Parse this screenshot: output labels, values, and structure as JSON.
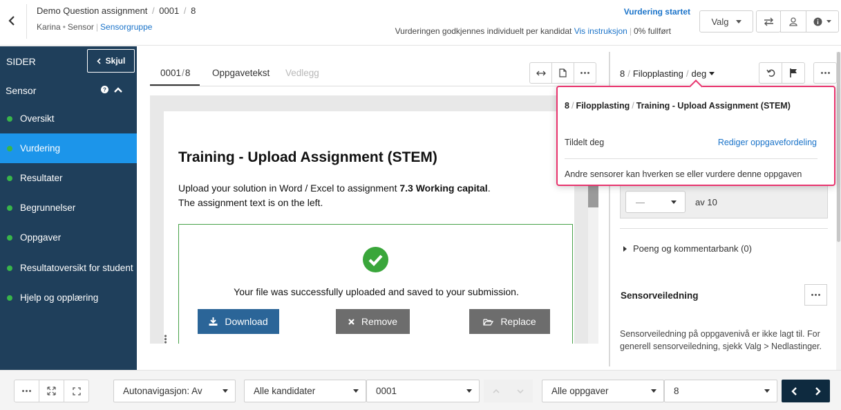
{
  "header": {
    "title": "Demo Question assignment",
    "candidate": "0001",
    "question_no": "8",
    "sensor_name": "Karina",
    "role": "Sensor",
    "group_link": "Sensorgruppe",
    "status_started": "Vurdering startet",
    "approval_text": "Vurderingen godkjennes individuelt per kandidat",
    "instructions_link": "Vis instruksjon",
    "progress_text": "0% fullført",
    "valg_label": "Valg"
  },
  "sidebar": {
    "title": "SIDER",
    "hide_label": "Skjul",
    "section": "Sensor",
    "items": [
      {
        "label": "Oversikt"
      },
      {
        "label": "Vurdering"
      },
      {
        "label": "Resultater"
      },
      {
        "label": "Begrunnelser"
      },
      {
        "label": "Oppgaver"
      },
      {
        "label": "Resultatoversikt for student"
      },
      {
        "label": "Hjelp og opplæring"
      }
    ]
  },
  "tabs": {
    "candidate_tab": "0001",
    "candidate_tab_count": "8",
    "task_text": "Oppgavetekst",
    "attachments": "Vedlegg"
  },
  "document": {
    "heading": "Training - Upload Assignment (STEM)",
    "line1_start": "Upload your solution in Word / Excel to assignment ",
    "line1_bold": "7.3 Working capital",
    "line1_end": ".",
    "line2": "The assignment text is on the left.",
    "success_text": "Your file was successfully uploaded and saved to your submission.",
    "download_label": "Download",
    "remove_label": "Remove",
    "replace_label": "Replace"
  },
  "right_panel": {
    "task_number": "8",
    "task_type": "Filopplasting",
    "assignee": "deg",
    "score_placeholder": "—",
    "score_max_text": "av 10",
    "bank_label": "Poeng og kommentarbank (0)",
    "guide_title": "Sensorveiledning",
    "guide_text": "Sensorveiledning på oppgavenivå er ikke lagt til. For generell sensorveiledning, sjekk Valg > Nedlastinger."
  },
  "popup": {
    "number": "8",
    "type": "Filopplasting",
    "title": "Training - Upload Assignment (STEM)",
    "assigned_label": "Tildelt deg",
    "edit_link": "Rediger oppgavefordeling",
    "note": "Andre sensorer kan hverken se eller vurdere denne oppgaven"
  },
  "bottom": {
    "autonav": "Autonavigasjon: Av",
    "candidates_filter": "Alle kandidater",
    "candidate_value": "0001",
    "tasks_filter": "Alle oppgaver",
    "task_value": "8"
  },
  "colors": {
    "sidebar_bg": "#1f3f5b",
    "active_nav": "#1c95ea",
    "status_green": "#39b54a",
    "link_blue": "#1a73c9",
    "highlight_pink": "#e8336d",
    "download_btn": "#2b6598",
    "grey_btn": "#6d6d6d",
    "nav_dark": "#0e2a3f"
  }
}
